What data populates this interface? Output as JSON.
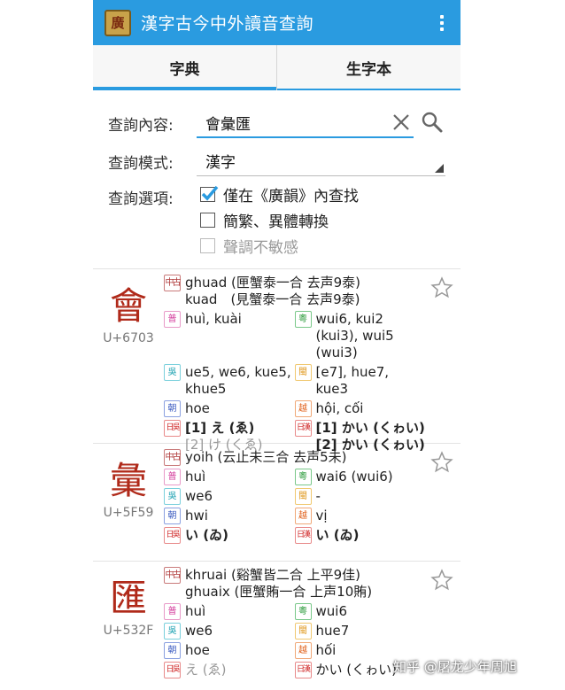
{
  "app": {
    "icon_label": "廣",
    "title": "漢字古今中外讀音查詢"
  },
  "tabs": [
    {
      "label": "字典",
      "active": true
    },
    {
      "label": "生字本",
      "active": false
    }
  ],
  "form": {
    "query_label": "查詢內容:",
    "query_value": "會彙匯",
    "mode_label": "查詢模式:",
    "mode_value": "漢字",
    "options_label": "查詢選項:",
    "options": [
      {
        "label": "僅在《廣韻》內查找",
        "checked": true,
        "enabled": true
      },
      {
        "label": "簡繁、異體轉換",
        "checked": false,
        "enabled": true
      },
      {
        "label": "聲調不敏感",
        "checked": false,
        "enabled": false
      }
    ]
  },
  "badges": {
    "mc": "中古",
    "pu": "普",
    "yue": "粵",
    "wu": "吳",
    "min": "閩",
    "ko": "朝",
    "vi": "越",
    "jp_go": "日吳",
    "jp_kan": "日漢"
  },
  "entries": [
    {
      "char": "會",
      "code": "U+6703",
      "mc": [
        "ghuad (匣蟹泰一合 去声9泰)",
        "kuad　(見蟹泰一合 去声9泰)"
      ],
      "pu": "huì, kuài",
      "yue": "wui6, kui2 (kui3), wui5 (wui3)",
      "wu": "ue5, we6, kue5, khue5",
      "min": "[e7], hue7, kue3",
      "ko": "hoe",
      "vi": "hội, cối",
      "jp_go": [
        "[1] え (ゑ)",
        "[2] け (くゑ)"
      ],
      "jp_kan": [
        "[1] かい (くゎい)",
        "[2] かい (くゎい)"
      ]
    },
    {
      "char": "彙",
      "code": "U+5F59",
      "mc": [
        "yoih (云止未三合 去声5未)"
      ],
      "pu": "huì",
      "yue": "wai6 (wui6)",
      "wu": "we6",
      "min": "-",
      "ko": "hwi",
      "vi": "vị",
      "jp_go": [
        "い (ゐ)"
      ],
      "jp_kan": [
        "い (ゐ)"
      ]
    },
    {
      "char": "匯",
      "code": "U+532F",
      "mc": [
        "khruai (谿蟹皆二合 上平9佳)",
        "ghuaix (匣蟹賄一合 上声10賄)"
      ],
      "pu": "huì",
      "yue": "wui6",
      "wu": "we6",
      "min": "hue7",
      "ko": "hoe",
      "vi": "hối",
      "jp_go": [
        "え (ゑ)"
      ],
      "jp_kan": [
        "かい (くゎい)"
      ]
    }
  ],
  "watermark": "知乎 @屠龙少年周旭",
  "colors": {
    "accent": "#2a9be0",
    "char": "#b02a1a"
  }
}
